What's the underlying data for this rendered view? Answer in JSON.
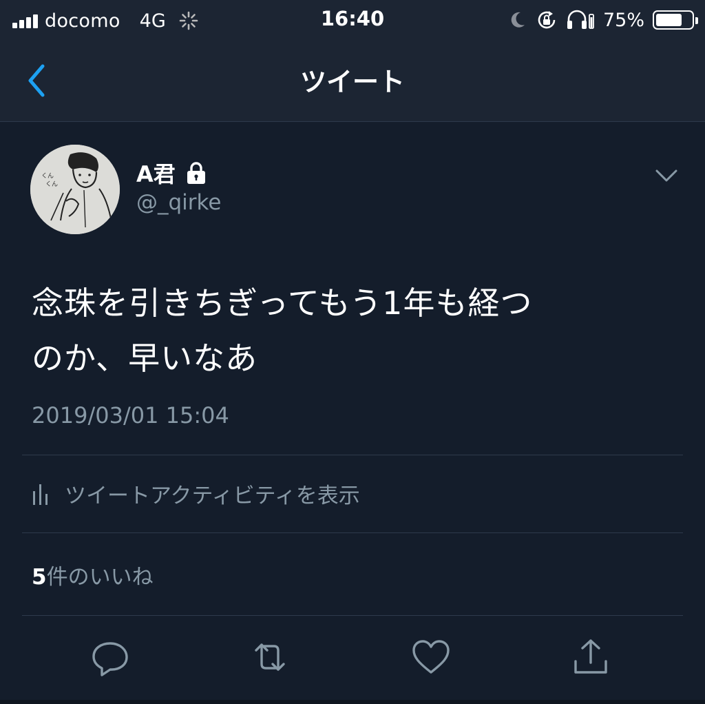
{
  "status_bar": {
    "carrier": "docomo",
    "network": "4G",
    "time": "16:40",
    "battery_percent": "75%",
    "battery_level": 0.75,
    "icons": [
      "signal-icon",
      "loading-spinner-icon",
      "moon-icon",
      "rotation-lock-icon",
      "headphones-icon",
      "battery-icon"
    ]
  },
  "nav": {
    "title": "ツイート",
    "back_icon": "chevron-left-icon"
  },
  "tweet": {
    "author_name": "A君",
    "author_handle": "@_qirke",
    "protected_icon": "lock-icon",
    "text_line1": "念珠を引きちぎってもう1年も経つ",
    "text_line2": "のか、早いなあ",
    "timestamp": "2019/03/01 15:04",
    "activity_label": "ツイートアクティビティを表示",
    "likes_count": "5",
    "likes_label": "件のいいね"
  },
  "actions": [
    "reply-icon",
    "retweet-icon",
    "like-icon",
    "share-icon"
  ],
  "colors": {
    "background": "#141d2b",
    "header": "#1c2533",
    "accent": "#1da1f2",
    "muted_text": "#8899a6",
    "divider": "#2e3a4c"
  }
}
